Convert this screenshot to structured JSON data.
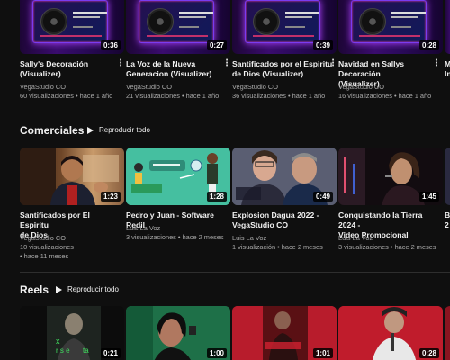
{
  "top_videos": [
    {
      "title_l1": "Sally's Decoración",
      "title_l2": "(Visualizer)",
      "channel": "VegaStudio CO",
      "stats": "60 visualizaciones • hace 1 año",
      "duration": "0:36"
    },
    {
      "title_l1": "La Voz de la Nueva",
      "title_l2": "Generacion (Visualizer)",
      "channel": "VegaStudio CO",
      "stats": "21 visualizaciones • hace 1 año",
      "duration": "0:27"
    },
    {
      "title_l1": "Santificados por el Espiritu",
      "title_l2": "de Dios (Visualizer)",
      "channel": "VegaStudio CO",
      "stats": "36 visualizaciones • hace 1 año",
      "duration": "0:39"
    },
    {
      "title_l1": "Navidad en Sallys Decoración",
      "title_l2": "(Visualizer)",
      "channel": "VegaStudio CO",
      "stats": "16 visualizaciones • hace 1 año",
      "duration": "0:28"
    },
    {
      "title_l1": "M",
      "title_l2": "In",
      "channel": "",
      "stats": "",
      "duration": ""
    }
  ],
  "comerciales": {
    "title": "Comerciales",
    "play_all": "Reproducir todo",
    "videos": [
      {
        "title_l1": "Santificados por El Espiritu",
        "title_l2": "de Dios",
        "channel": "VegaStudio CO",
        "stats_l1": "10 visualizaciones",
        "stats_l2": "• hace 11 meses",
        "duration": "1:23"
      },
      {
        "title_l1": "Pedro y Juan - Software Redil",
        "title_l2": "",
        "channel": "Luis La Voz",
        "stats_l1": "3 visualizaciones • hace 2 meses",
        "stats_l2": "",
        "duration": "1:28"
      },
      {
        "title_l1": "Explosion Dagua 2022 -",
        "title_l2": "VegaStudio CO",
        "channel": "Luis La Voz",
        "stats_l1": "1 visualización • hace 2 meses",
        "stats_l2": "",
        "duration": "0:49"
      },
      {
        "title_l1": "Conquistando la Tierra 2024 -",
        "title_l2": "Video Promocional",
        "channel": "Luis La Voz",
        "stats_l1": "3 visualizaciones • hace 2 meses",
        "stats_l2": "",
        "duration": "1:45"
      },
      {
        "title_l1": "B",
        "title_l2": "2",
        "channel": "",
        "stats_l1": "",
        "stats_l2": "",
        "duration": ""
      }
    ]
  },
  "reels": {
    "title": "Reels",
    "play_all": "Reproducir todo",
    "durations": [
      "0:21",
      "1:00",
      "1:01",
      "0:28"
    ]
  },
  "kebab": "⋮"
}
